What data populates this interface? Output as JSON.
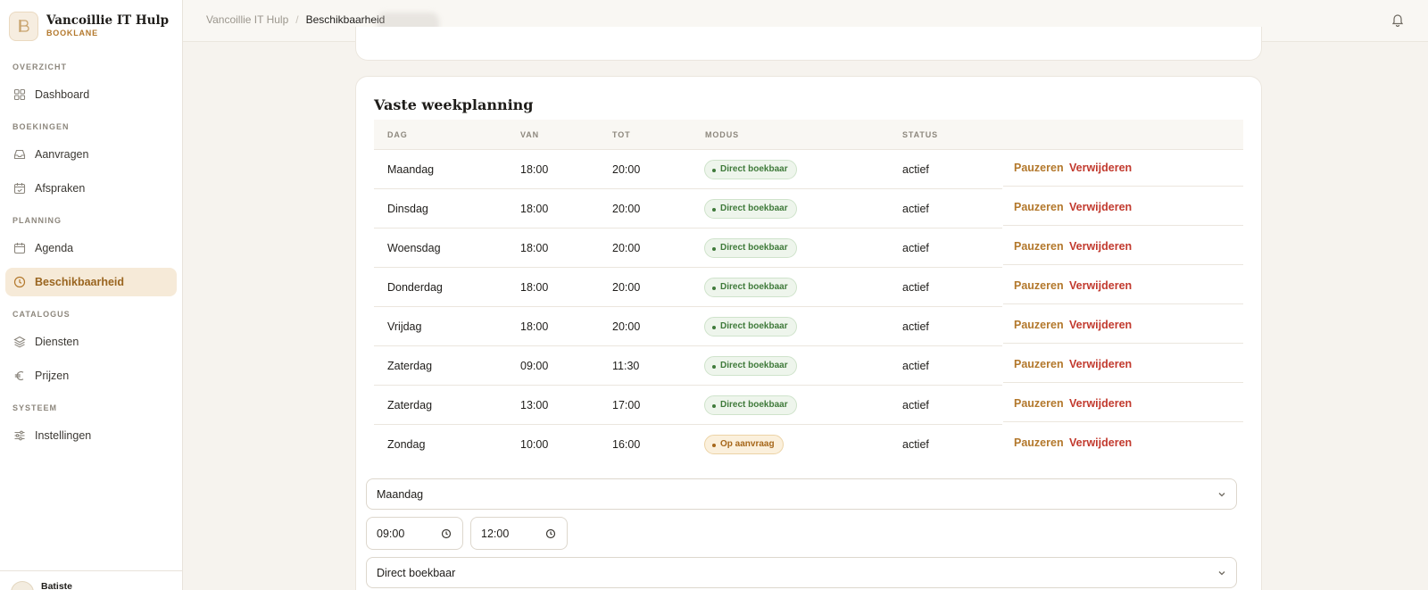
{
  "brand": {
    "name": "Vancoillie IT Hulp",
    "sub": "BOOKLANE"
  },
  "sidebar": {
    "sections": [
      {
        "label": "OVERZICHT",
        "items": [
          {
            "label": "Dashboard",
            "icon": "grid-icon"
          }
        ]
      },
      {
        "label": "BOEKINGEN",
        "items": [
          {
            "label": "Aanvragen",
            "icon": "inbox-icon"
          },
          {
            "label": "Afspraken",
            "icon": "calendar-check-icon"
          }
        ]
      },
      {
        "label": "PLANNING",
        "items": [
          {
            "label": "Agenda",
            "icon": "calendar-icon"
          },
          {
            "label": "Beschikbaarheid",
            "icon": "clock-icon",
            "active": true
          }
        ]
      },
      {
        "label": "CATALOGUS",
        "items": [
          {
            "label": "Diensten",
            "icon": "layers-icon"
          },
          {
            "label": "Prijzen",
            "icon": "euro-icon"
          }
        ]
      },
      {
        "label": "SYSTEEM",
        "items": [
          {
            "label": "Instellingen",
            "icon": "sliders-icon"
          }
        ]
      }
    ],
    "user": {
      "name": "Batiste"
    }
  },
  "topbar": {
    "crumb_root": "Vancoillie IT Hulp",
    "crumb_current": "Beschikbaarheid"
  },
  "weekplanning": {
    "title": "Vaste weekplanning",
    "columns": {
      "day": "DAG",
      "from": "VAN",
      "to": "TOT",
      "mode": "MODUS",
      "status": "STATUS"
    },
    "actions": {
      "pause": "Pauzeren",
      "delete": "Verwijderen"
    },
    "rows": [
      {
        "day": "Maandag",
        "from": "18:00",
        "to": "20:00",
        "mode": "Direct boekbaar",
        "tone": "green",
        "status": "actief"
      },
      {
        "day": "Dinsdag",
        "from": "18:00",
        "to": "20:00",
        "mode": "Direct boekbaar",
        "tone": "green",
        "status": "actief"
      },
      {
        "day": "Woensdag",
        "from": "18:00",
        "to": "20:00",
        "mode": "Direct boekbaar",
        "tone": "green",
        "status": "actief"
      },
      {
        "day": "Donderdag",
        "from": "18:00",
        "to": "20:00",
        "mode": "Direct boekbaar",
        "tone": "green",
        "status": "actief"
      },
      {
        "day": "Vrijdag",
        "from": "18:00",
        "to": "20:00",
        "mode": "Direct boekbaar",
        "tone": "green",
        "status": "actief"
      },
      {
        "day": "Zaterdag",
        "from": "09:00",
        "to": "11:30",
        "mode": "Direct boekbaar",
        "tone": "green",
        "status": "actief"
      },
      {
        "day": "Zaterdag",
        "from": "13:00",
        "to": "17:00",
        "mode": "Direct boekbaar",
        "tone": "green",
        "status": "actief"
      },
      {
        "day": "Zondag",
        "from": "10:00",
        "to": "16:00",
        "mode": "Op aanvraag",
        "tone": "amber",
        "status": "actief"
      }
    ]
  },
  "form": {
    "day_value": "Maandag",
    "from_value": "09:00",
    "to_value": "12:00",
    "mode_value": "Direct boekbaar"
  }
}
